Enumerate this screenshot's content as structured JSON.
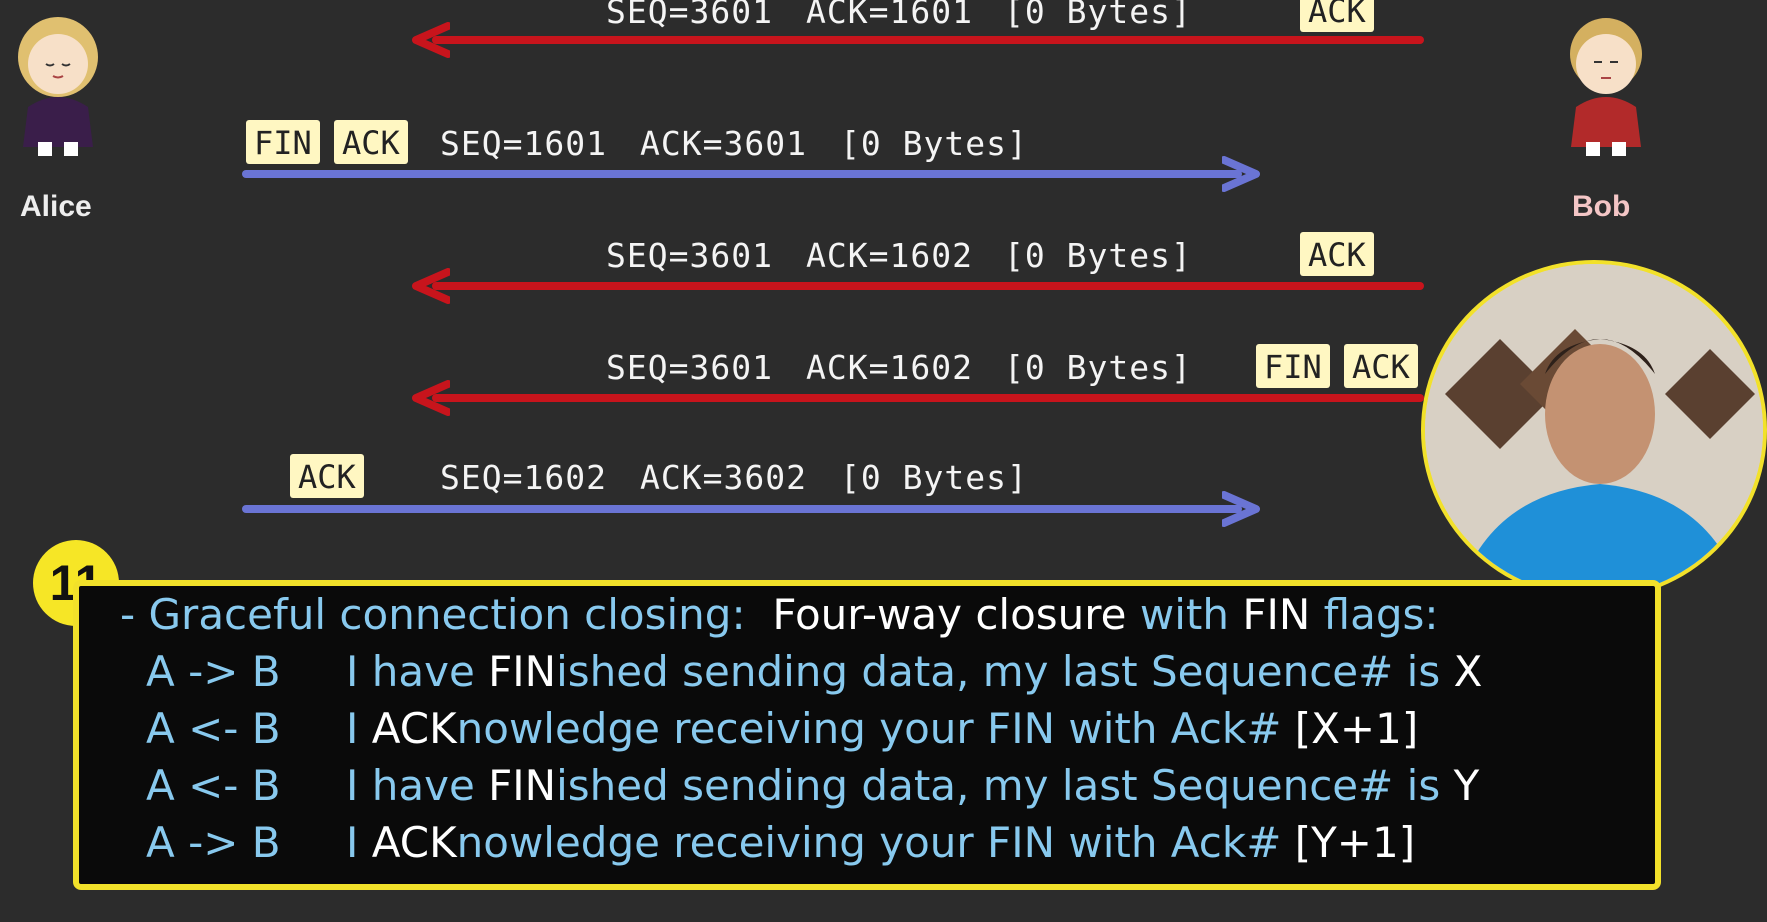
{
  "participants": {
    "left": "Alice",
    "right": "Bob"
  },
  "messages": [
    {
      "seq": "SEQ=3601",
      "ack": "ACK=1601",
      "bytes": "[0 Bytes]",
      "flags": [
        "ACK"
      ],
      "direction": "B->A"
    },
    {
      "seq": "SEQ=1601",
      "ack": "ACK=3601",
      "bytes": "[0 Bytes]",
      "flags": [
        "FIN",
        "ACK"
      ],
      "direction": "A->B"
    },
    {
      "seq": "SEQ=3601",
      "ack": "ACK=1602",
      "bytes": "[0 Bytes]",
      "flags": [
        "ACK"
      ],
      "direction": "B->A"
    },
    {
      "seq": "SEQ=3601",
      "ack": "ACK=1602",
      "bytes": "[0 Bytes]",
      "flags": [
        "FIN",
        "ACK"
      ],
      "direction": "B->A"
    },
    {
      "seq": "SEQ=1602",
      "ack": "ACK=3602",
      "bytes": "[0 Bytes]",
      "flags": [
        "ACK"
      ],
      "direction": "A->B"
    }
  ],
  "badge": "11",
  "summary": {
    "heading_prefix": "- Graceful connection closing:",
    "heading_bold": "Four-way closure",
    "heading_mid": "with",
    "heading_fin": "FIN",
    "heading_suffix": "flags:",
    "rows": [
      {
        "dir": "A -> B",
        "pre": "I have ",
        "bold": "FIN",
        "rest": "ished sending data, my last Sequence# is ",
        "end": "X"
      },
      {
        "dir": "A <- B",
        "pre": "I ",
        "bold": "ACK",
        "rest": "nowledge receiving your FIN with Ack# ",
        "end": "[X+1]"
      },
      {
        "dir": "A <- B",
        "pre": "I have ",
        "bold": "FIN",
        "rest": "ished sending data, my last Sequence# is ",
        "end": "Y"
      },
      {
        "dir": "A -> B",
        "pre": "I ",
        "bold": "ACK",
        "rest": "nowledge receiving your FIN with Ack# ",
        "end": "[Y+1]"
      }
    ]
  },
  "colors": {
    "b_to_a": "#c8141c",
    "a_to_b": "#6a74d4",
    "panel_border": "#f2e12a",
    "summary_text": "#88c9ee"
  }
}
